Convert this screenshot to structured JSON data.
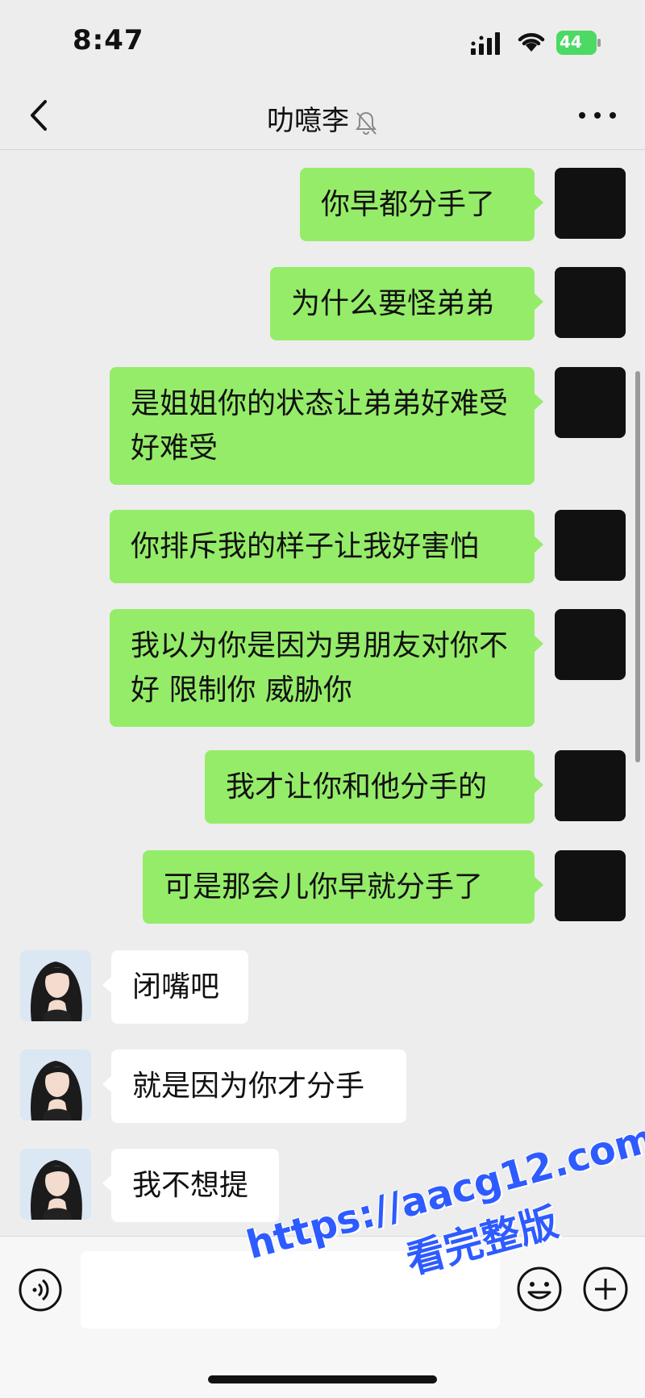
{
  "status": {
    "time": "8:47",
    "battery": "44"
  },
  "header": {
    "contact_name": "叻噫李",
    "icons": {
      "back": "chevron-left-icon",
      "mute": "bell-off-icon",
      "more": "more-dots-icon"
    }
  },
  "messages": [
    {
      "from": "me",
      "text": "你早都分手了"
    },
    {
      "from": "me",
      "text": "为什么要怪弟弟"
    },
    {
      "from": "me",
      "text": "是姐姐你的状态让弟弟好难受好难受"
    },
    {
      "from": "me",
      "text": "你排斥我的样子让我好害怕"
    },
    {
      "from": "me",
      "text": "我以为你是因为男朋友对你不好 限制你 威胁你"
    },
    {
      "from": "me",
      "text": "我才让你和他分手的"
    },
    {
      "from": "me",
      "text": "可是那会儿你早就分手了"
    },
    {
      "from": "her",
      "text": "闭嘴吧"
    },
    {
      "from": "her",
      "text": "就是因为你才分手"
    },
    {
      "from": "her",
      "text": "我不想提"
    }
  ],
  "watermark": {
    "url": "https://aacg12.com",
    "subtitle": "看完整版"
  },
  "input_bar": {
    "text_value": "",
    "icons": {
      "voice": "voice-icon",
      "emoji": "emoji-icon",
      "add": "plus-icon"
    }
  }
}
